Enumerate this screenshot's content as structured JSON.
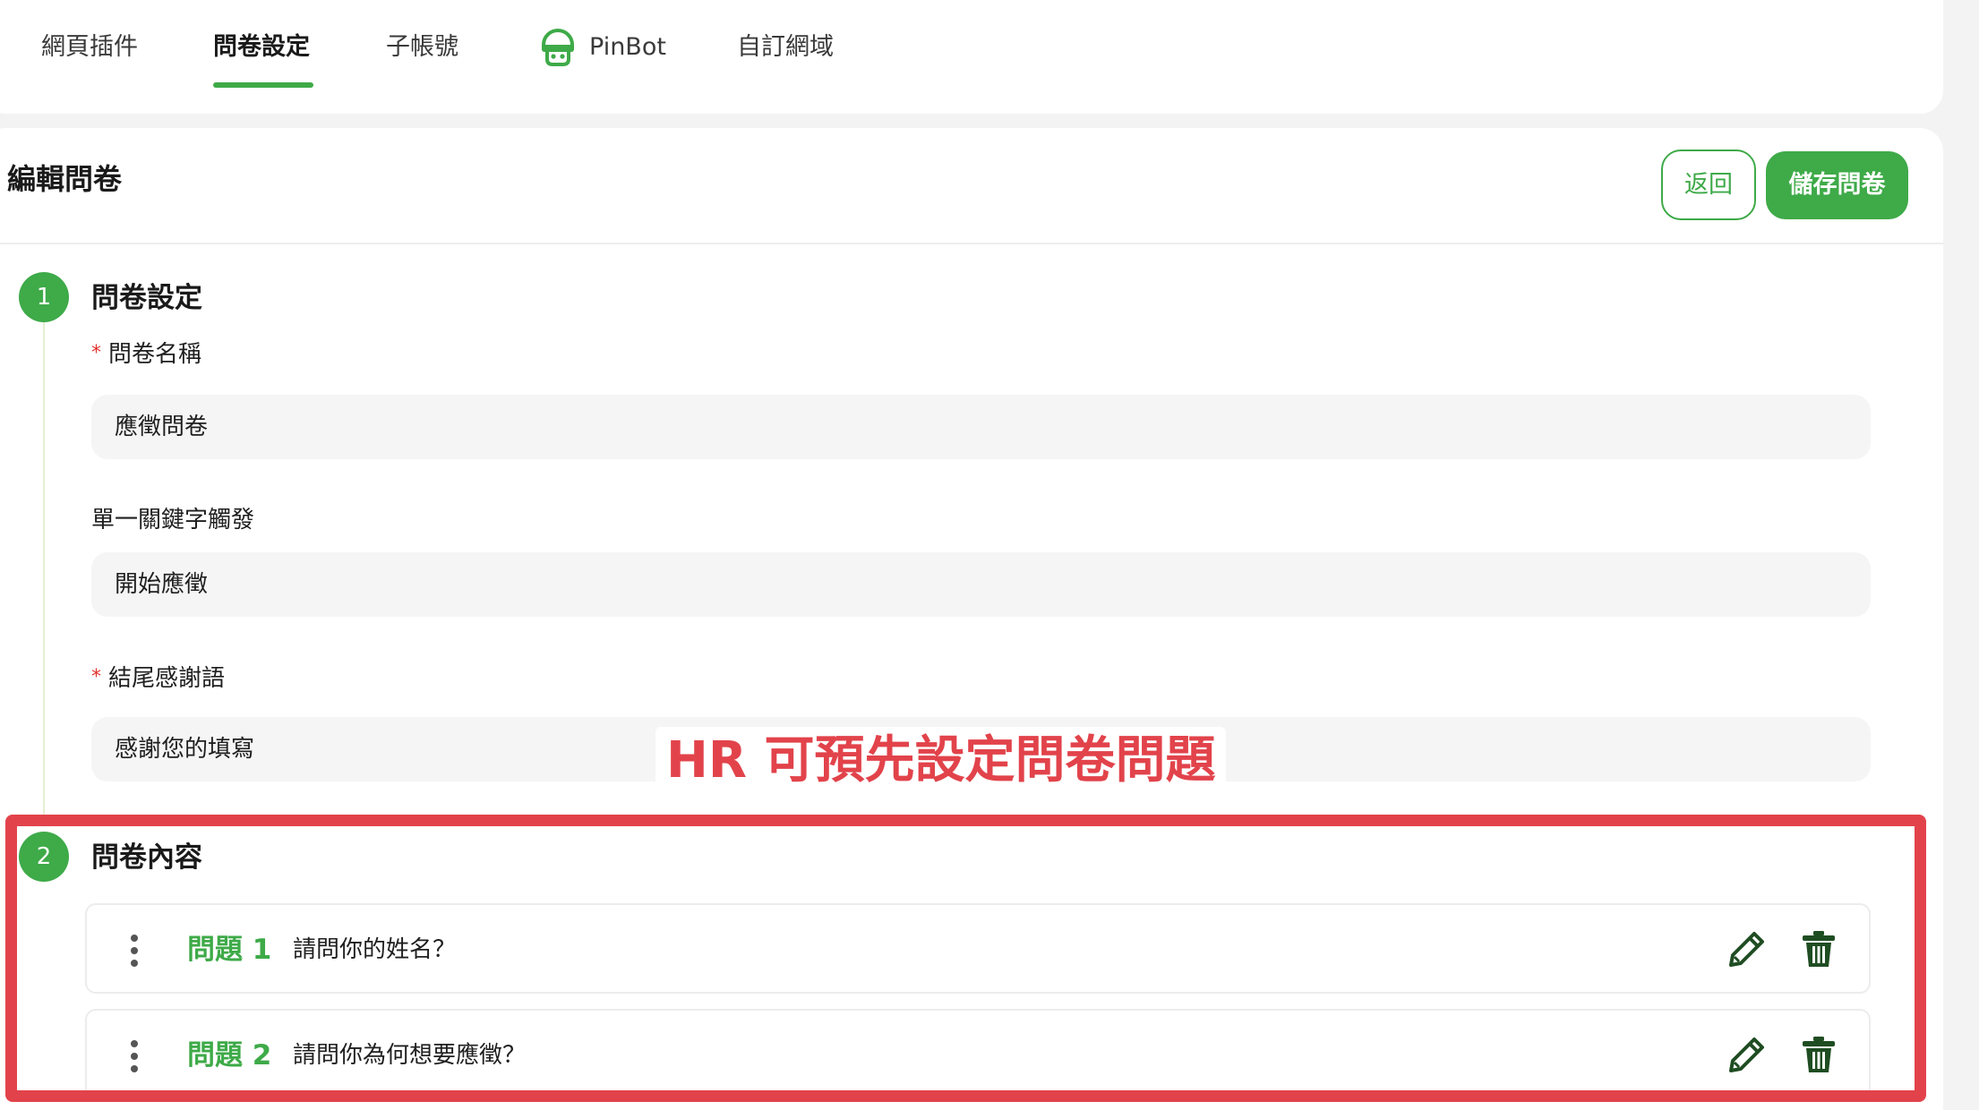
{
  "tabs": [
    {
      "label": "網頁插件"
    },
    {
      "label": "問卷設定"
    },
    {
      "label": "子帳號"
    },
    {
      "label": "PinBot",
      "icon": "pinbot-robot-icon"
    },
    {
      "label": "自訂網域"
    }
  ],
  "active_tab": "問卷設定",
  "page": {
    "title": "編輯問卷",
    "back_label": "返回",
    "save_label": "儲存問卷"
  },
  "section1": {
    "step": "1",
    "title": "問卷設定",
    "fields": [
      {
        "label": "問卷名稱",
        "required": true,
        "value": "應徵問卷"
      },
      {
        "label": "單一關鍵字觸發",
        "required": false,
        "value": "開始應徵"
      },
      {
        "label": "結尾感謝語",
        "required": true,
        "value": "感謝您的填寫"
      }
    ]
  },
  "required_mark": "*",
  "section2": {
    "step": "2",
    "title": "問卷內容",
    "questions": [
      {
        "label": "問題 1",
        "text": "請問你的姓名？"
      },
      {
        "label": "問題 2",
        "text": "請問你為何想要應徵？"
      }
    ]
  },
  "annotation": {
    "text": "HR 可預先設定問卷問題"
  },
  "colors": {
    "brand_green": "#3eaa48",
    "annotation_red": "#e2434b",
    "required_red": "#e3342f",
    "input_bg": "#f5f5f5"
  }
}
